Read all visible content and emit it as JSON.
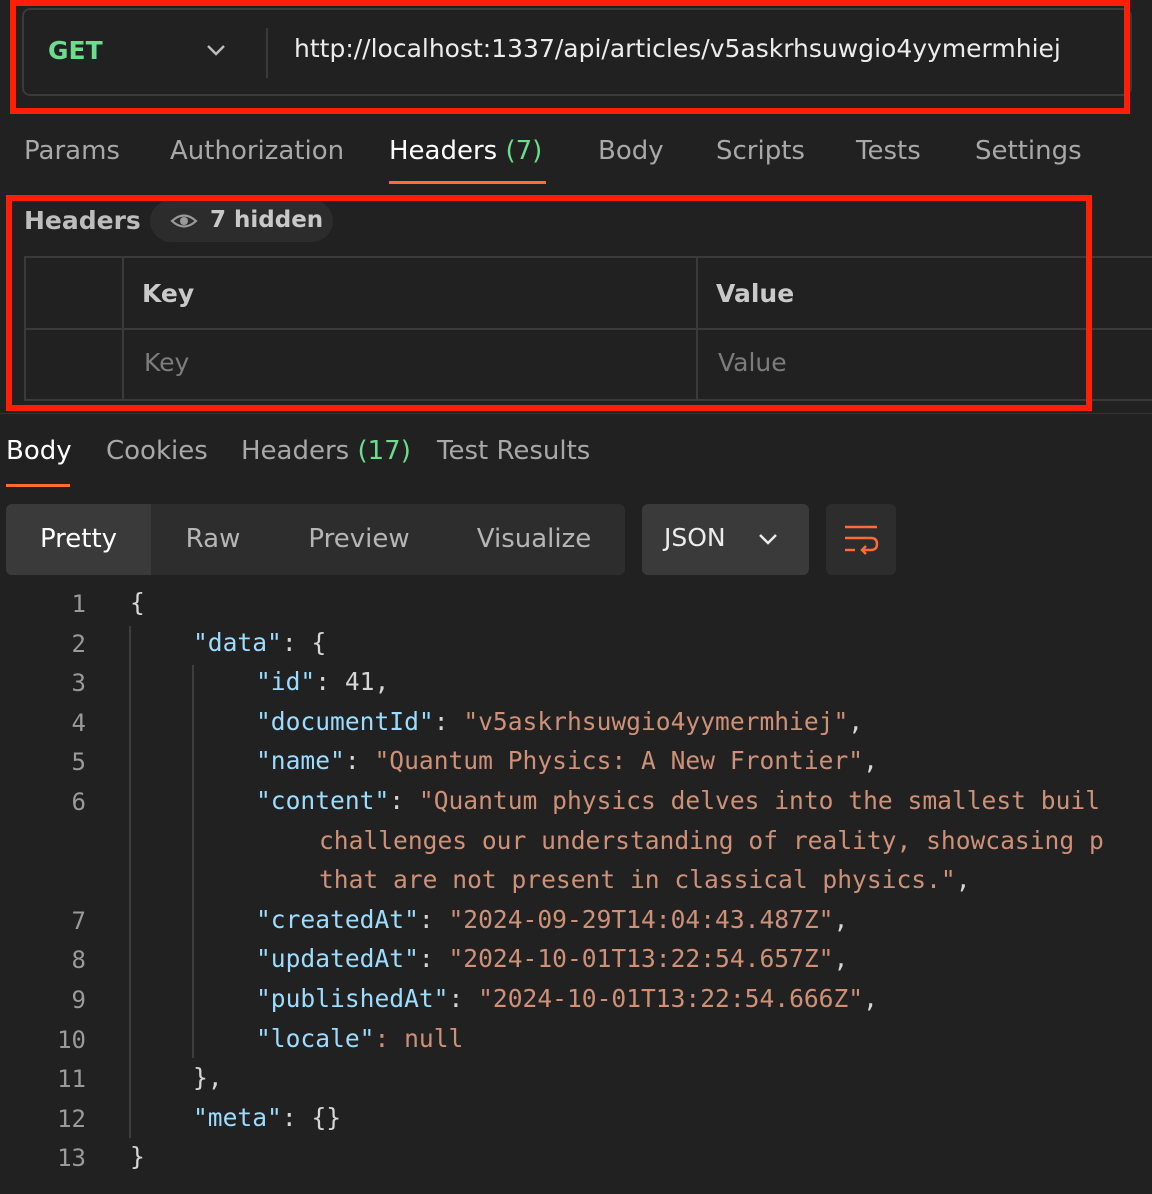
{
  "request": {
    "method": "GET",
    "url": "http://localhost:1337/api/articles/v5askrhsuwgio4yymermhiej"
  },
  "request_tabs": [
    {
      "label": "Params"
    },
    {
      "label": "Authorization"
    },
    {
      "label": "Headers",
      "count": "(7)"
    },
    {
      "label": "Body"
    },
    {
      "label": "Scripts"
    },
    {
      "label": "Tests"
    },
    {
      "label": "Settings"
    }
  ],
  "headers_section": {
    "title": "Headers",
    "hidden_label": "7 hidden",
    "columns": {
      "key": "Key",
      "value": "Value"
    },
    "new_row": {
      "key_placeholder": "Key",
      "value_placeholder": "Value"
    }
  },
  "response_tabs": [
    {
      "label": "Body"
    },
    {
      "label": "Cookies"
    },
    {
      "label": "Headers",
      "count": "(17)"
    },
    {
      "label": "Test Results"
    }
  ],
  "view_modes": [
    "Pretty",
    "Raw",
    "Preview",
    "Visualize"
  ],
  "format": "JSON",
  "colors": {
    "accent": "#ff6c37",
    "method_get": "#6bdd8f",
    "highlight_box": "#ff1e06",
    "json_key": "#9cdcfe",
    "json_string": "#ce9178"
  },
  "code": {
    "line_numbers": [
      "1",
      "2",
      "3",
      "4",
      "5",
      "6",
      "7",
      "8",
      "9",
      "10",
      "11",
      "12",
      "13"
    ],
    "l1": "{",
    "l2_key": "\"data\"",
    "l2_rest": ": {",
    "l3_key": "\"id\"",
    "l3_rest": ": 41,",
    "l4_key": "\"documentId\"",
    "l4_val": "\"v5askrhsuwgio4yymermhiej\"",
    "l5_key": "\"name\"",
    "l5_val": "\"Quantum Physics: A New Frontier\"",
    "l6_key": "\"content\"",
    "l6_val": "\"Quantum physics delves into the smallest buil",
    "l6_cont1": "challenges our understanding of reality, showcasing p",
    "l6_cont2": "that are not present in classical physics.\"",
    "l7_key": "\"createdAt\"",
    "l7_val": "\"2024-09-29T14:04:43.487Z\"",
    "l8_key": "\"updatedAt\"",
    "l8_val": "\"2024-10-01T13:22:54.657Z\"",
    "l9_key": "\"publishedAt\"",
    "l9_val": "\"2024-10-01T13:22:54.666Z\"",
    "l10_key": "\"locale\"",
    "l10_rest": ": null",
    "l11": "},",
    "l12_key": "\"meta\"",
    "l12_rest": ": {}",
    "l13": "}"
  }
}
